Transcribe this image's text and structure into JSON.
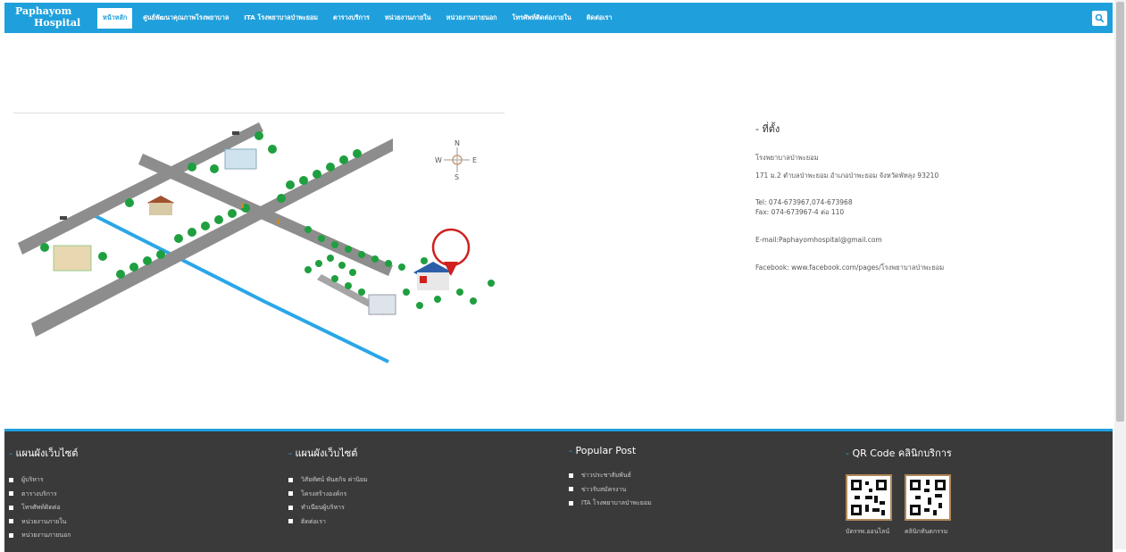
{
  "nav": {
    "logo_line1": "Paphayom",
    "logo_line2": "Hospital",
    "items": [
      {
        "label": "หน้าหลัก"
      },
      {
        "label": "ศูนย์พัฒนาคุณภาพโรงพยาบาล"
      },
      {
        "label": "ITA โรงพยาบาลป่าพะยอม"
      },
      {
        "label": "ตารางบริการ"
      },
      {
        "label": "หน่วยงานภายใน"
      },
      {
        "label": "หน่วยงานภายนอก"
      },
      {
        "label": "โทรศัพท์ติดต่อภายใน"
      },
      {
        "label": "ติดต่อเรา"
      }
    ],
    "search_icon": "search-icon",
    "accent": "#1fa0dc"
  },
  "map": {
    "compass": {
      "n": "N",
      "s": "S",
      "e": "E",
      "w": "W"
    }
  },
  "info": {
    "heading": "- ที่ตั้ง",
    "name": "โรงพยาบาลป่าพะยอม",
    "address": "171 ม.2 ตำบลป่าพะยอม อำเภอป่าพะยอม จังหวัดพัทลุง 93210",
    "tel": "Tel: 074-673967,074-673968",
    "fax": "Fax: 074-673967-4 ต่อ 110",
    "email": "E-mail:Paphayomhospital@gmail.com",
    "facebook": "Facebook: www.facebook.com/pages/โรงพยาบาลป่าพะยอม"
  },
  "footer": {
    "bg": "#3a3a3a",
    "columns": [
      {
        "dash": "- ",
        "title": "แผนผังเว็บไซต์",
        "items": [
          "ผู้บริหาร",
          "ตารางบริการ",
          "โทรศัพท์ติดต่อ",
          "หน่วยงานภายใน",
          "หน่วยงานภายนอก"
        ]
      },
      {
        "dash": "- ",
        "title": "แผนผังเว็บไซต์",
        "items": [
          "วิสัยทัศน์ พันธกิจ ค่านิยม",
          "โครงสร้างองค์กร",
          "ทำเนียบผู้บริหาร",
          "ติดต่อเรา"
        ]
      },
      {
        "dash": "- ",
        "title": "Popular Post",
        "items": [
          "ข่าวประชาสัมพันธ์",
          "ข่าวรับสมัครงาน",
          "ITA โรงพยาบาลป่าพะยอม"
        ]
      }
    ],
    "qr": {
      "dash": "- ",
      "title": "QR Code คลินิกบริการ",
      "captions": [
        "บัตรรพ.ออนไลน์",
        "คลินิกทันตกรรม"
      ]
    }
  }
}
